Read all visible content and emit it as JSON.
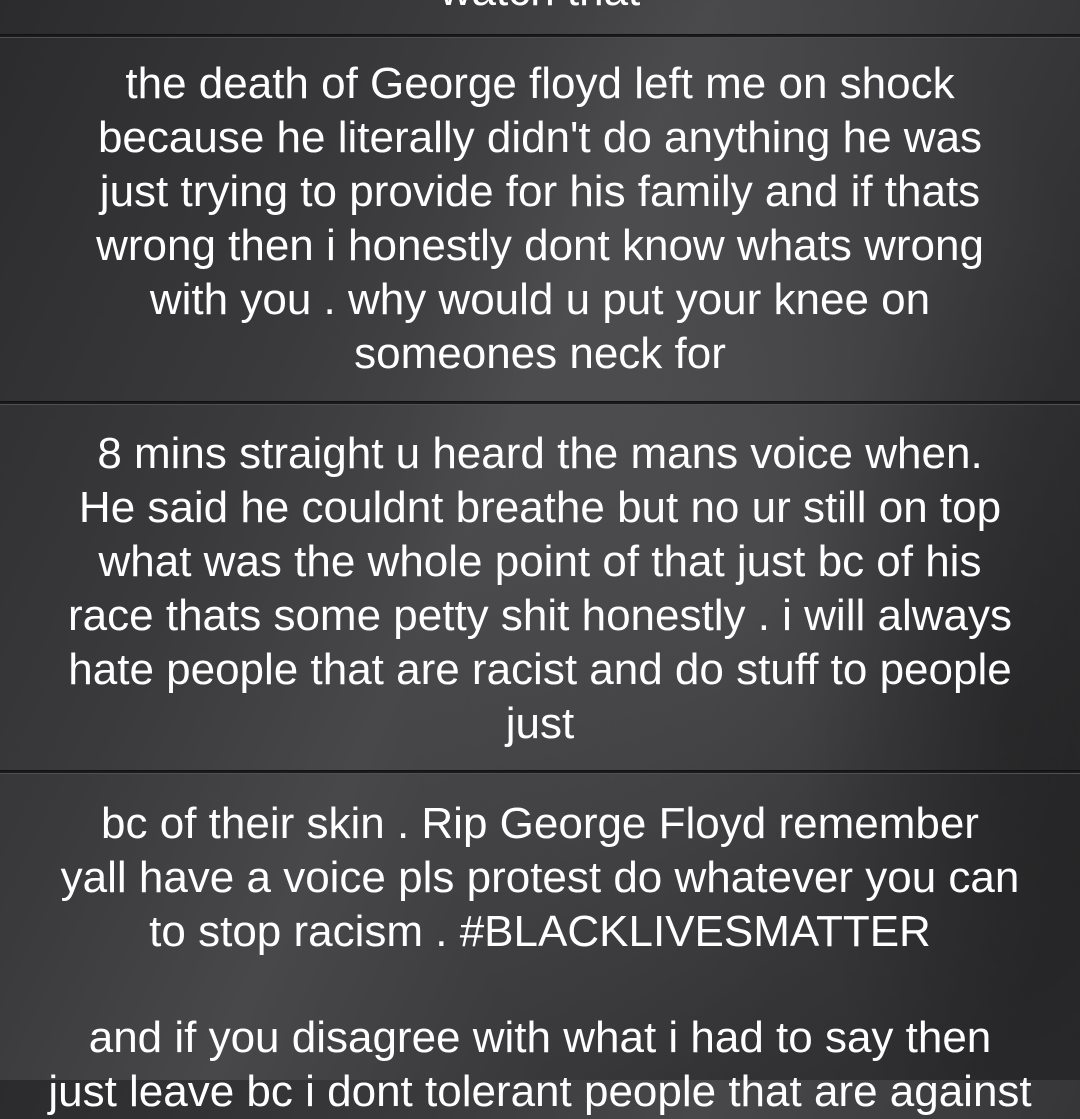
{
  "cells": [
    {
      "text": "watch that"
    },
    {
      "text": "the death of George floyd left me on shock\nbecause he literally didn't do anything he was\njust trying to provide for his family and if thats\nwrong then i honestly dont know whats wrong\nwith you . why would u put your knee on\nsomeones neck for"
    },
    {
      "text": "8 mins straight u heard the mans voice when.\nHe said he couldnt breathe but no ur still on top\nwhat was the whole point of that just bc of his\nrace thats some petty shit honestly . i will always\nhate people that are racist and do stuff to people\njust"
    },
    {
      "text": "bc of their skin . Rip George Floyd remember\nyall have a voice pls protest do whatever you can\nto stop racism . #BLACKLIVESMATTER"
    },
    {
      "text": "and if you disagree with what i had to say then\njust leave bc i dont tolerant people that are against"
    }
  ]
}
